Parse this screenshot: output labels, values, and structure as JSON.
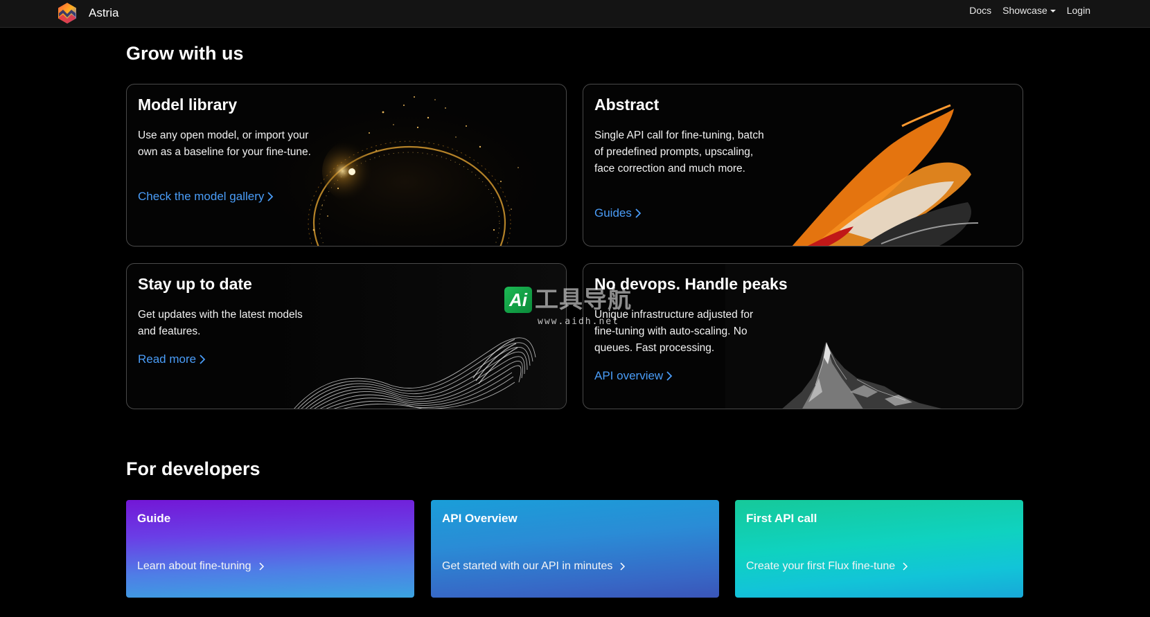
{
  "app": {
    "name": "Astria"
  },
  "nav": {
    "docs": "Docs",
    "showcase": "Showcase",
    "login": "Login"
  },
  "sections": {
    "grow": "Grow with us",
    "developers": "For developers"
  },
  "cards": [
    {
      "title": "Model library",
      "description": "Use any open model, or import your own as a baseline for your fine-tune.",
      "link": "Check the model gallery"
    },
    {
      "title": "Abstract",
      "description": "Single API call for fine-tuning, batch of predefined prompts, upscaling, face correction and much more.",
      "link": "Guides"
    },
    {
      "title": "Stay up to date",
      "description": "Get updates with the latest models and features.",
      "link": "Read more"
    },
    {
      "title": "No devops. Handle peaks",
      "description": "Unique infrastructure adjusted for fine-tuning with auto-scaling. No queues. Fast processing.",
      "link": "API overview"
    }
  ],
  "dev_cards": [
    {
      "title": "Guide",
      "link": "Learn about fine-tuning"
    },
    {
      "title": "API Overview",
      "link": "Get started with our API in minutes"
    },
    {
      "title": "First API call",
      "link": "Create your first Flux fine-tune"
    }
  ],
  "watermark": {
    "badge": "Ai",
    "text": "工具导航",
    "url": "www.aidh.net"
  }
}
